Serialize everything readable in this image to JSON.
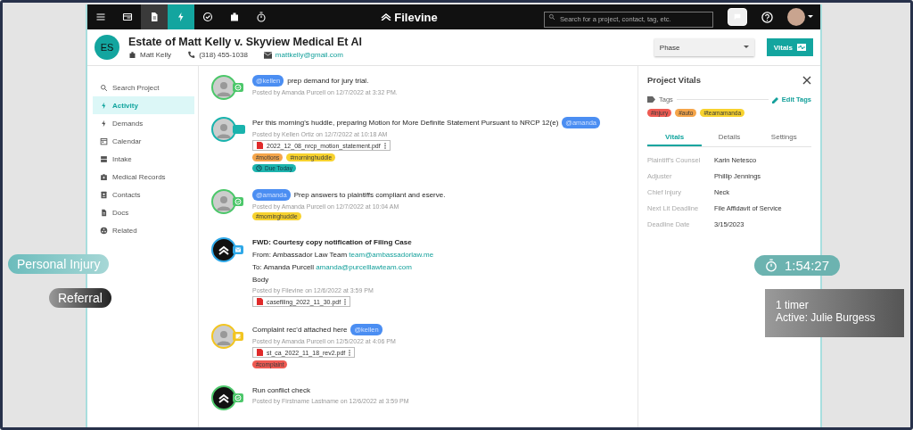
{
  "toolbar": {
    "icons": [
      {
        "kind": "menu",
        "selected": false,
        "hovered": false
      },
      {
        "kind": "panel",
        "selected": false,
        "hovered": false
      },
      {
        "kind": "document",
        "selected": false,
        "hovered": true
      },
      {
        "kind": "bolt",
        "selected": true,
        "hovered": false
      },
      {
        "kind": "check",
        "selected": false,
        "hovered": false
      },
      {
        "kind": "briefcase",
        "selected": false,
        "hovered": false
      },
      {
        "kind": "stopwatch",
        "selected": false,
        "hovered": false
      }
    ],
    "logo": "Filevine",
    "search": {
      "placeholder": "Search for a project, contact, tag, etc."
    }
  },
  "project": {
    "initials": "ES",
    "title": "Estate of Matt Kelly v. Skyview Medical Et Al",
    "client": "Matt Kelly",
    "phone": "(318) 455-1038",
    "email": "mattkelly@gmail.com",
    "phase": {
      "placeholder": "Phase"
    },
    "vitals_button": "Vitals"
  },
  "sidebar": {
    "items": [
      {
        "kind": "search",
        "label": "Search Project",
        "selected": false
      },
      {
        "kind": "bolt",
        "label": "Activity",
        "selected": true
      },
      {
        "kind": "bolt",
        "label": "Demands",
        "selected": false
      },
      {
        "kind": "calendar",
        "label": "Calendar",
        "selected": false
      },
      {
        "kind": "intake",
        "label": "Intake",
        "selected": false
      },
      {
        "kind": "medical",
        "label": "Medical Records",
        "selected": false
      },
      {
        "kind": "contacts",
        "label": "Contacts",
        "selected": false
      },
      {
        "kind": "docs",
        "label": "Docs",
        "selected": false
      },
      {
        "kind": "related",
        "label": "Related",
        "selected": false
      }
    ]
  },
  "feed": [
    {
      "kind": "note",
      "avatar": {
        "kind": "person"
      },
      "color": "#4cc76a",
      "badge": {
        "kind": "check"
      },
      "mention_before": "@kellen",
      "text": "prep demand for jury trial.",
      "meta": "Posted by Amanda Purcell on 12/7/2022 at 3:32 PM."
    },
    {
      "kind": "note",
      "avatar": {
        "kind": "person"
      },
      "color": "#19b3ad",
      "badge": {
        "kind": "plain"
      },
      "text": "Per this morning's huddle, preparing Motion for More Definite Statement Pursuant to NRCP 12(e)",
      "mention_after": "@amanda",
      "meta": "Posted by Kellen Ortiz on 12/7/2022 at 10:18 AM",
      "attachments": [
        "2022_12_08_nrcp_motion_statement.pdf"
      ],
      "tags": [
        {
          "label": "#motions",
          "color": "#f5a54a"
        },
        {
          "label": "#morninghuddle",
          "color": "#f7d22e"
        }
      ],
      "due": "Due Today"
    },
    {
      "kind": "note",
      "avatar": {
        "kind": "person"
      },
      "color": "#4cc76a",
      "badge": {
        "kind": "check"
      },
      "mention_before": "@amanda",
      "text": "Prep answers to plaintiffs compliant and eserve.",
      "meta": "Posted by Amanda Purcell on 12/7/2022 at 10:04 AM",
      "tags": [
        {
          "label": "#morninghuddle",
          "color": "#f7d22e"
        }
      ]
    },
    {
      "kind": "email",
      "avatar": {
        "kind": "logo"
      },
      "color": "#2ea8e8",
      "badge": {
        "kind": "mail"
      },
      "subject": "FWD: Courtesy copy notification of Filing Case",
      "from": "From: Ambassador Law Team",
      "from_email": "team@ambassadorlaw.me",
      "to": "To: Amanda Purcell",
      "to_email": "amanda@purcelllawteam.com",
      "body": "Body",
      "meta": "Posted by Filevine on 12/6/2022 at 3:59 PM",
      "attachments": [
        "casefiling_2022_11_30.pdf"
      ]
    },
    {
      "kind": "note",
      "avatar": {
        "kind": "person"
      },
      "color": "#f2c522",
      "badge": {
        "kind": "note"
      },
      "text": "Complaint rec'd attached here",
      "mention_after": "@kellen",
      "meta": "Posted by Amanda Purcell on 12/5/2022 at 4:06 PM",
      "attachments": [
        "st_ca_2022_11_18_rev2.pdf"
      ],
      "tags": [
        {
          "label": "#complaint",
          "color": "#ee5a52"
        }
      ]
    },
    {
      "kind": "note",
      "avatar": {
        "kind": "logo"
      },
      "color": "#4cc76a",
      "badge": {
        "kind": "check"
      },
      "text": "Run conflict check",
      "meta": "Posted by Firstname Lastname on 12/6/2022 at 3:59 PM"
    }
  ],
  "vitals": {
    "title": "Project Vitals",
    "tags_label": "Tags",
    "edit_tags": "Edit Tags",
    "tags": [
      {
        "label": "#injury",
        "color": "#ee5a52"
      },
      {
        "label": "#auto",
        "color": "#f5a54a"
      },
      {
        "label": "#teamamanda",
        "color": "#f7d22e"
      }
    ],
    "tabs": [
      {
        "label": "Vitals",
        "selected": true
      },
      {
        "label": "Details",
        "selected": false
      },
      {
        "label": "Settings",
        "selected": false
      }
    ],
    "fields": [
      {
        "label": "Plaintiff's Counsel",
        "value": "Karin Netesco"
      },
      {
        "label": "Adjuster",
        "value": "Phillip Jennings"
      },
      {
        "label": "Chief Injury",
        "value": "Neck"
      },
      {
        "label": "Next Lit Deadline",
        "value": "File Affidavit of Service"
      },
      {
        "label": "Deadline Date",
        "value": "3/15/2023"
      }
    ]
  },
  "overlays": {
    "chips": [
      {
        "label": "Personal Injury",
        "kind": "teal"
      },
      {
        "label": "Referral",
        "kind": "dark"
      }
    ],
    "timer": "1:54:27",
    "timer_info": [
      "1 timer",
      "Active: Julie Burgess"
    ]
  }
}
